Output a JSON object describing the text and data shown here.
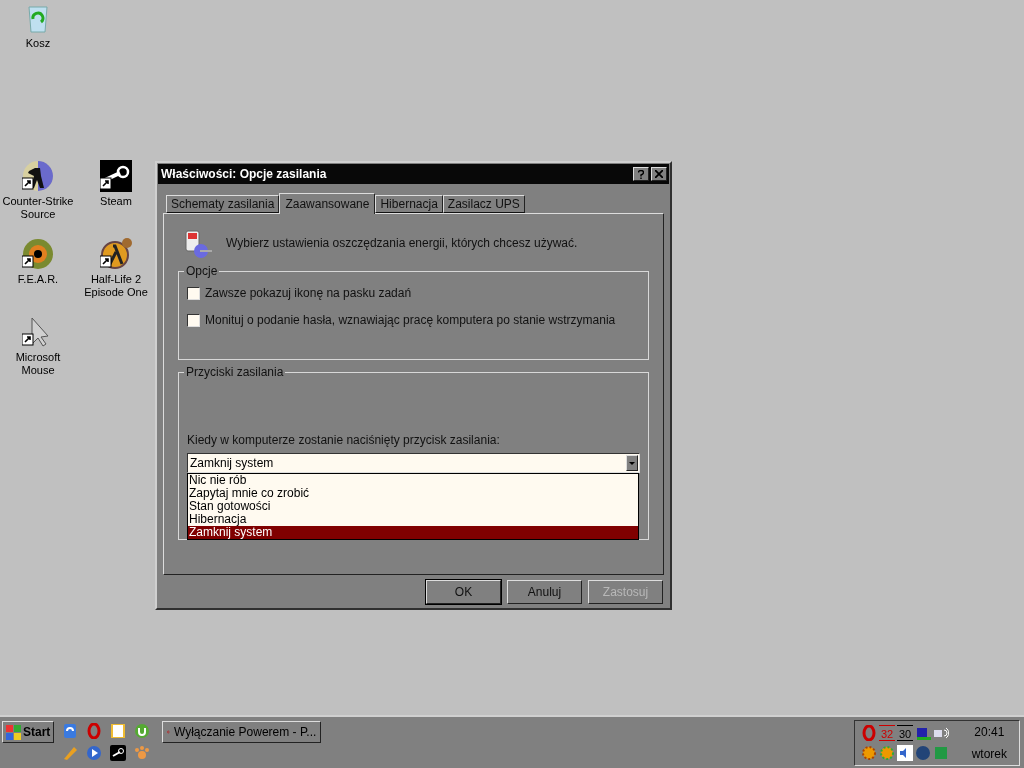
{
  "desktop_icons": [
    {
      "label": "Kosz",
      "shortcut": false
    },
    {
      "label": "Counter-Strike Source",
      "shortcut": true
    },
    {
      "label": "Steam",
      "shortcut": true
    },
    {
      "label": "F.E.A.R.",
      "shortcut": true
    },
    {
      "label": "Half-Life 2 Episode One",
      "shortcut": true
    },
    {
      "label": "Microsoft Mouse",
      "shortcut": true
    }
  ],
  "dialog": {
    "title": "Właściwości: Opcje zasilania",
    "tabs": [
      {
        "label": "Schematy zasilania",
        "selected": false
      },
      {
        "label": "Zaawansowane",
        "selected": true
      },
      {
        "label": "Hibernacja",
        "selected": false
      },
      {
        "label": "Zasilacz UPS",
        "selected": false
      }
    ],
    "intro": "Wybierz ustawienia oszczędzania energii, których chcesz używać.",
    "options_group": {
      "title": "Opcje",
      "checkboxes": [
        {
          "label": "Zawsze pokazuj ikonę na pasku zadań",
          "checked": false
        },
        {
          "label": "Monituj o podanie hasła, wznawiając pracę komputera po stanie wstrzymania",
          "checked": false
        }
      ]
    },
    "power_group": {
      "title": "Przyciski zasilania",
      "label": "Kiedy w komputerze zostanie naciśnięty przycisk zasilania:",
      "dropdown": {
        "value": "Zamknij system",
        "expanded": true,
        "options": [
          {
            "label": "Nic nie rób",
            "selected": false
          },
          {
            "label": "Zapytaj mnie co zrobić",
            "selected": false
          },
          {
            "label": "Stan gotowości",
            "selected": false
          },
          {
            "label": "Hibernacja",
            "selected": false
          },
          {
            "label": "Zamknij system",
            "selected": true
          }
        ]
      }
    },
    "buttons": [
      {
        "label": "OK",
        "disabled": false
      },
      {
        "label": "Anuluj",
        "disabled": false
      },
      {
        "label": "Zastosuj",
        "disabled": true
      }
    ]
  },
  "taskbar": {
    "start": "Start",
    "task": "Wyłączanie Powerem - P...",
    "tray_readings": [
      "32",
      "30"
    ],
    "time": "20:41",
    "day": "wtorek"
  }
}
